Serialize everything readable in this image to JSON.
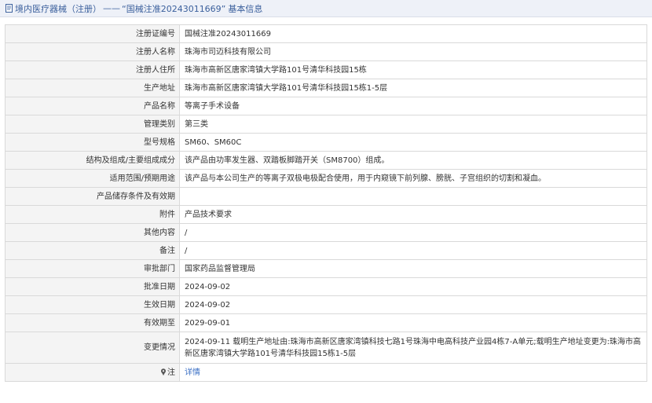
{
  "breadcrumb": {
    "link": "境内医疗器械（注册）",
    "separator": "——",
    "reg_title": "“国械注准20243011669”",
    "suffix": "基本信息"
  },
  "rows": [
    {
      "label": "注册证编号",
      "value": "国械注准20243011669"
    },
    {
      "label": "注册人名称",
      "value": "珠海市司迈科技有限公司"
    },
    {
      "label": "注册人住所",
      "value": "珠海市高新区唐家湾镇大学路101号清华科技园15栋"
    },
    {
      "label": "生产地址",
      "value": "珠海市高新区唐家湾镇大学路101号清华科技园15栋1-5层"
    },
    {
      "label": "产品名称",
      "value": "等离子手术设备"
    },
    {
      "label": "管理类别",
      "value": "第三类"
    },
    {
      "label": "型号规格",
      "value": "SM60、SM60C"
    },
    {
      "label": "结构及组成/主要组成成分",
      "value": "该产品由功率发生器、双踏板脚踏开关（SM8700）组成。"
    },
    {
      "label": "适用范围/预期用途",
      "value": "该产品与本公司生产的等离子双极电极配合使用，用于内窥镜下前列腺、膀胱、子宫组织的切割和凝血。"
    },
    {
      "label": "产品储存条件及有效期",
      "value": ""
    },
    {
      "label": "附件",
      "value": "产品技术要求"
    },
    {
      "label": "其他内容",
      "value": "/"
    },
    {
      "label": "备注",
      "value": "/"
    },
    {
      "label": "审批部门",
      "value": "国家药品监督管理局"
    },
    {
      "label": "批准日期",
      "value": "2024-09-02"
    },
    {
      "label": "生效日期",
      "value": "2024-09-02"
    },
    {
      "label": "有效期至",
      "value": "2029-09-01"
    },
    {
      "label": "变更情况",
      "value": "2024-09-11 载明生产地址由:珠海市高新区唐家湾镇科技七路1号珠海中电高科技产业园4栋7-A单元;载明生产地址变更为:珠海市高新区唐家湾镇大学路101号清华科技园15栋1-5层"
    }
  ],
  "note_row": {
    "label": "注",
    "link": "详情"
  }
}
